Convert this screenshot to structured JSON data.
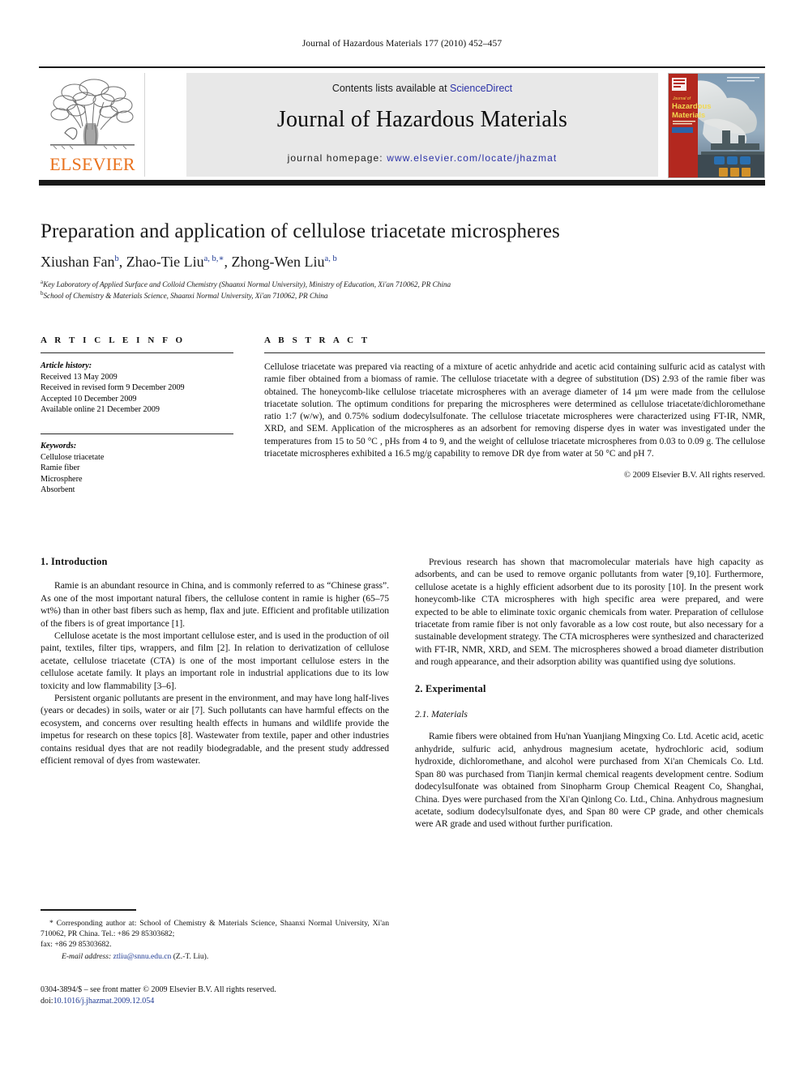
{
  "running_head": "Journal of Hazardous Materials 177 (2010) 452–457",
  "masthead": {
    "contents_prefix": "Contents lists available at ",
    "sciencedirect": "ScienceDirect",
    "journal_name": "Journal of Hazardous Materials",
    "homepage_prefix": "journal homepage: ",
    "homepage_url": "www.elsevier.com/locate/jhazmat",
    "publisher_wordmark": "ELSEVIER",
    "publisher_color": "#E9711C",
    "link_color": "#2b32a8",
    "cover_title_line1": "Journal of",
    "cover_title_line2": "Hazardous",
    "cover_title_line3": "Materials"
  },
  "article": {
    "title": "Preparation and application of cellulose triacetate microspheres",
    "authors": [
      {
        "name": "Xiushan Fan",
        "marks": "b"
      },
      {
        "name": "Zhao-Tie Liu",
        "marks": "a, b,∗"
      },
      {
        "name": "Zhong-Wen Liu",
        "marks": "a, b"
      }
    ],
    "affiliations": [
      {
        "mark": "a",
        "text": "Key Laboratory of Applied Surface and Colloid Chemistry (Shaanxi Normal University), Ministry of Education, Xi'an 710062, PR China"
      },
      {
        "mark": "b",
        "text": "School of Chemistry & Materials Science, Shaanxi Normal University, Xi'an 710062, PR China"
      }
    ]
  },
  "article_info": {
    "heading": "A R T I C L E  I N F O",
    "history_label": "Article history:",
    "history": [
      "Received 13 May 2009",
      "Received in revised form 9 December 2009",
      "Accepted 10 December 2009",
      "Available online 21 December 2009"
    ],
    "keywords_label": "Keywords:",
    "keywords": [
      "Cellulose triacetate",
      "Ramie fiber",
      "Microsphere",
      "Absorbent"
    ]
  },
  "abstract": {
    "heading": "A B S T R A C T",
    "body": "Cellulose triacetate was prepared via reacting of a mixture of acetic anhydride and acetic acid containing sulfuric acid as catalyst with ramie fiber obtained from a biomass of ramie. The cellulose triacetate with a degree of substitution (DS) 2.93 of the ramie fiber was obtained. The honeycomb-like cellulose triacetate microspheres with an average diameter of 14 μm were made from the cellulose triacetate solution. The optimum conditions for preparing the microspheres were determined as cellulose triacetate/dichloromethane ratio 1:7 (w/w), and 0.75% sodium dodecylsulfonate. The cellulose triacetate microspheres were characterized using FT-IR, NMR, XRD, and SEM. Application of the microspheres as an adsorbent for removing disperse dyes in water was investigated under the temperatures from 15 to 50 °C , pHs from 4 to 9, and the weight of cellulose triacetate microspheres from 0.03 to 0.09 g. The cellulose triacetate microspheres exhibited a 16.5 mg/g capability to remove DR dye from water at 50 °C and pH 7.",
    "copyright": "© 2009 Elsevier B.V. All rights reserved."
  },
  "body": {
    "left": {
      "section_heading": "1. Introduction",
      "paragraphs": [
        "Ramie is an abundant resource in China, and is commonly referred to as “Chinese grass”. As one of the most important natural fibers, the cellulose content in ramie is higher (65–75 wt%) than in other bast fibers such as hemp, flax and jute. Efficient and profitable utilization of the fibers is of great importance [1].",
        "Cellulose acetate is the most important cellulose ester, and is used in the production of oil paint, textiles, filter tips, wrappers, and film [2]. In relation to derivatization of cellulose acetate, cellulose triacetate (CTA) is one of the most important cellulose esters in the cellulose acetate family. It plays an important role in industrial applications due to its low toxicity and low flammability [3–6].",
        "Persistent organic pollutants are present in the environment, and may have long half-lives (years or decades) in soils, water or air [7]. Such pollutants can have harmful effects on the ecosystem, and concerns over resulting health effects in humans and wildlife provide the impetus for research on these topics [8]. Wastewater from textile, paper and other industries contains residual dyes that are not readily biodegradable, and the present study addressed efficient removal of dyes from wastewater."
      ]
    },
    "right": {
      "paragraph_intro": "Previous research has shown that macromolecular materials have high capacity as adsorbents, and can be used to remove organic pollutants from water [9,10]. Furthermore, cellulose acetate is a highly efficient adsorbent due to its porosity [10]. In the present work honeycomb-like CTA microspheres with high specific area were prepared, and were expected to be able to eliminate toxic organic chemicals from water. Preparation of cellulose triacetate from ramie fiber is not only favorable as a low cost route, but also necessary for a sustainable development strategy. The CTA microspheres were synthesized and characterized with FT-IR, NMR, XRD, and SEM. The microspheres showed a broad diameter distribution and rough appearance, and their adsorption ability was quantified using dye solutions.",
      "section_heading": "2. Experimental",
      "subsection_heading": "2.1. Materials",
      "paragraph_materials": "Ramie fibers were obtained from Hu'nan Yuanjiang Mingxing Co. Ltd. Acetic acid, acetic anhydride, sulfuric acid, anhydrous magnesium acetate, hydrochloric acid, sodium hydroxide, dichloromethane, and alcohol were purchased from Xi'an Chemicals Co. Ltd. Span 80 was purchased from Tianjin kermal chemical reagents development centre. Sodium dodecylsulfonate was obtained from Sinopharm Group Chemical Reagent Co, Shanghai, China. Dyes were purchased from the Xi'an Qinlong Co. Ltd., China. Anhydrous magnesium acetate, sodium dodecylsulfonate dyes, and Span 80 were CP grade, and other chemicals were AR grade and used without further purification."
    }
  },
  "footnotes": {
    "corresponding": "* Corresponding author at: School of Chemistry & Materials Science, Shaanxi Normal University, Xi'an 710062, PR China. Tel.: +86 29 85303682;",
    "fax": "fax: +86 29 85303682.",
    "email_label": "E-mail address:",
    "email": "ztliu@snnu.edu.cn",
    "email_suffix": "(Z.-T. Liu).",
    "issn_line": "0304-3894/$ – see front matter © 2009 Elsevier B.V. All rights reserved.",
    "doi_label": "doi:",
    "doi": "10.1016/j.jhazmat.2009.12.054"
  }
}
